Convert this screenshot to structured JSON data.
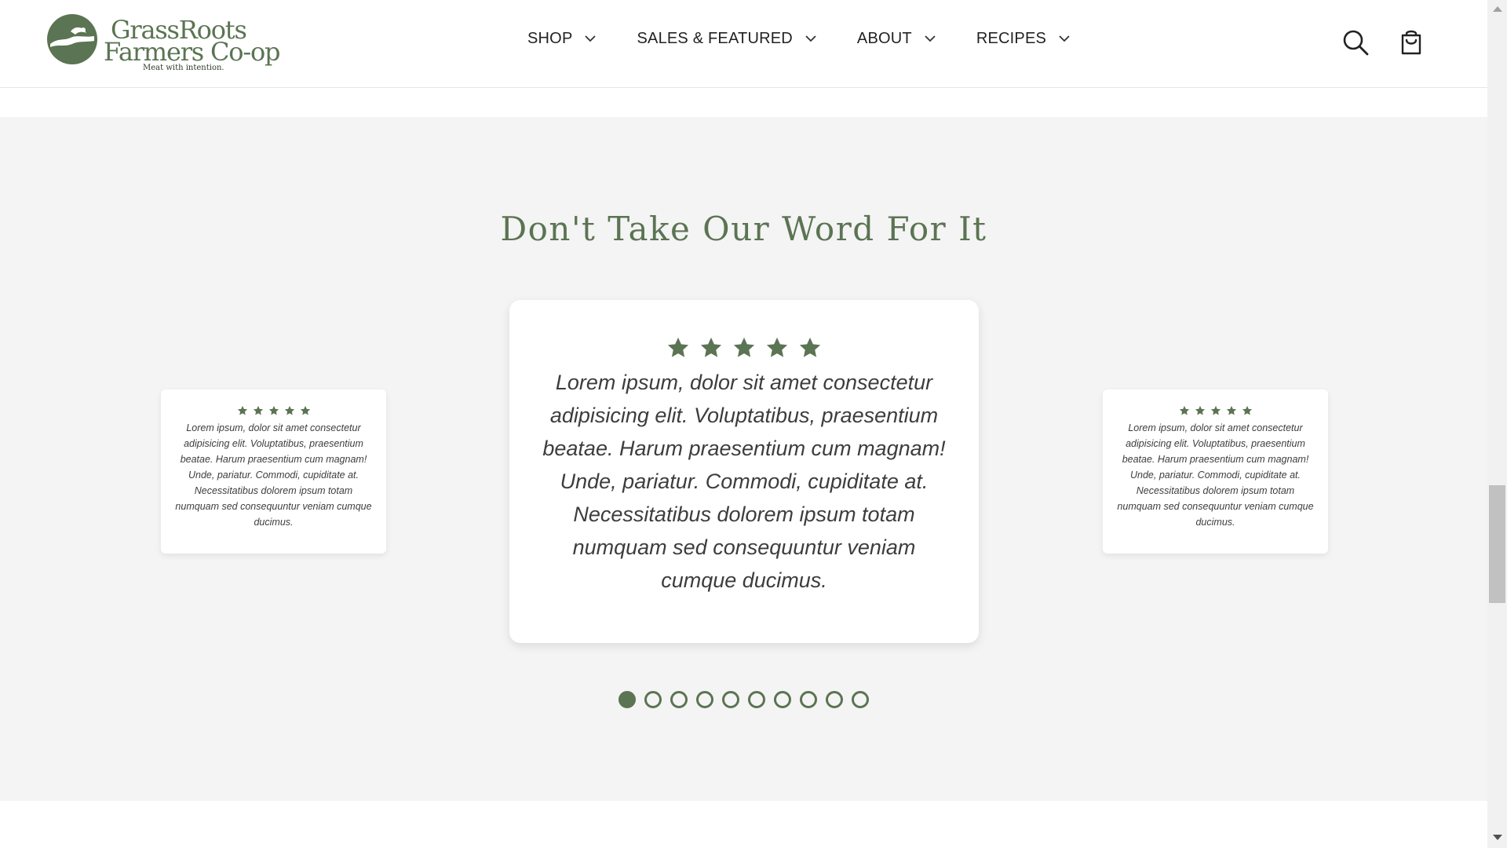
{
  "brand": {
    "name_line1": "GrassRoots",
    "name_line2": "Farmers Co-op",
    "tagline": "Meat with intention.",
    "accent_color": "#5b7453"
  },
  "nav": {
    "items": [
      {
        "label": "SHOP",
        "icon": "chevron-down-icon"
      },
      {
        "label": "SALES & FEATURED",
        "icon": "chevron-down-icon"
      },
      {
        "label": "ABOUT",
        "icon": "chevron-down-icon"
      },
      {
        "label": "RECIPES",
        "icon": "chevron-down-icon"
      }
    ]
  },
  "header_actions": {
    "search_icon": "search-icon",
    "cart_icon": "shopping-bag-icon"
  },
  "testimonials": {
    "title": "Don't Take Our Word For It",
    "background": "#f4f4f4",
    "cards": [
      {
        "position": "left",
        "rating": 5,
        "quote": "Lorem ipsum, dolor sit amet consectetur adipisicing elit. Voluptatibus, praesentium beatae. Harum praesentium cum magnam! Unde, pariatur. Commodi, cupiditate at. Necessitatibus dolorem ipsum totam numquam sed consequuntur veniam cumque ducimus."
      },
      {
        "position": "center",
        "rating": 5,
        "quote": "Lorem ipsum, dolor sit amet consectetur adipisicing elit. Voluptatibus, praesentium beatae. Harum praesentium cum magnam! Unde, pariatur. Commodi, cupiditate at. Necessitatibus dolorem ipsum totam numquam sed consequuntur veniam cumque ducimus."
      },
      {
        "position": "right",
        "rating": 5,
        "quote": "Lorem ipsum, dolor sit amet consectetur adipisicing elit. Voluptatibus, praesentium beatae. Harum praesentium cum magnam! Unde, pariatur. Commodi, cupiditate at. Necessitatibus dolorem ipsum totam numquam sed consequuntur veniam cumque ducimus."
      }
    ],
    "pagination": {
      "total": 10,
      "active_index": 0
    }
  }
}
